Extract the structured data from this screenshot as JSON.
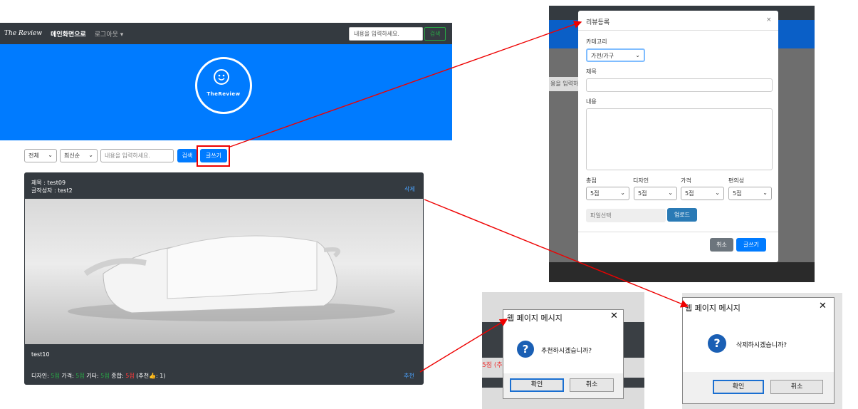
{
  "navbar": {
    "brand": "The Review",
    "home": "메인화면으로",
    "logout": "로그아웃 ▾",
    "search_placeholder": "내용을 입력하세요.",
    "search_button": "검색"
  },
  "hero": {
    "logo_text": "TheReview"
  },
  "filters": {
    "category": "전체",
    "sort": "최신순",
    "search_placeholder": "내용을 입력하세요.",
    "search_button": "검색",
    "write_button": "글쓰기"
  },
  "review_card": {
    "title": "제목 : test09",
    "author": "글작성자 : test2",
    "delete_label": "삭제",
    "content": "test10",
    "ratings": {
      "design_label": "디자인:",
      "design_value": "5점",
      "price_label": "가격:",
      "price_value": "5점",
      "other_label": "기타:",
      "other_value": "5점",
      "total_label": "종합:",
      "total_value": "5점",
      "recommend_text": "(추천👍: 1)"
    },
    "recommend_label": "추천"
  },
  "modal": {
    "side_input_text": "용을 입력하",
    "title": "리뷰등록",
    "close": "×",
    "category_label": "카테고리",
    "category_value": "가전/가구",
    "title_label": "제목",
    "content_label": "내용",
    "ratings": [
      {
        "label": "총점",
        "value": "5점"
      },
      {
        "label": "디자인",
        "value": "5점"
      },
      {
        "label": "가격",
        "value": "5점"
      },
      {
        "label": "편의성",
        "value": "5점"
      }
    ],
    "file_placeholder": "파일선택",
    "upload_button": "업로드",
    "cancel_button": "취소",
    "submit_button": "글쓰기"
  },
  "dialog_recommend": {
    "bg_text": "5점 (추",
    "title": "웹 페이지 메시지",
    "message": "추천하시겠습니까?",
    "ok": "확인",
    "cancel": "취소"
  },
  "dialog_delete": {
    "title": "웹 페이지 메시지",
    "message": "삭제하시겠습니까?",
    "ok": "확인",
    "cancel": "취소"
  },
  "colors": {
    "primary": "#007bff",
    "dark": "#343a40",
    "success": "#28a745",
    "danger": "#ff3b3b",
    "arrow": "#e00000"
  }
}
